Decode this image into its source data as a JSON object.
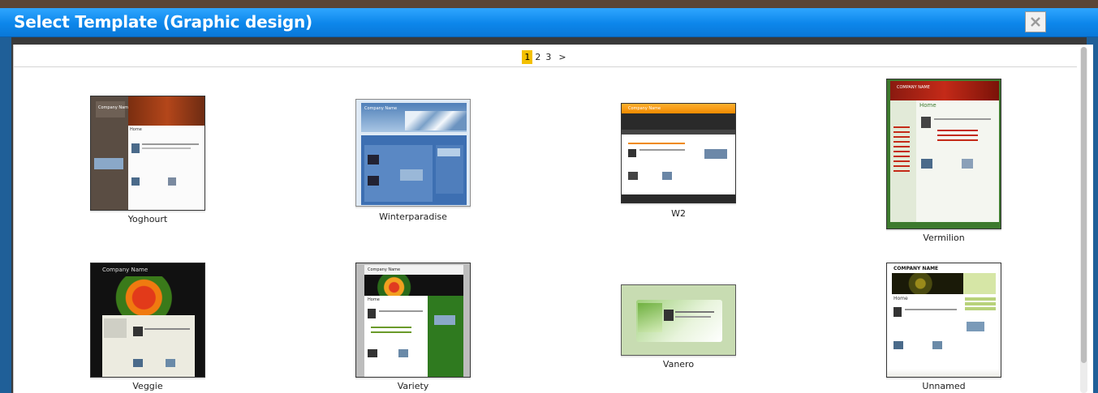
{
  "dialog": {
    "title": "Select Template (Graphic design)",
    "close_icon": "close-icon"
  },
  "pager": {
    "pages": [
      "1",
      "2",
      "3"
    ],
    "current": "1",
    "next_label": ">"
  },
  "templates": [
    {
      "name": "Yoghourt",
      "thumb_title": "Company Name",
      "thumb_heading": "Home"
    },
    {
      "name": "Winterparadise",
      "thumb_title": "Company Name"
    },
    {
      "name": "W2",
      "thumb_title": "Company Name"
    },
    {
      "name": "Vermilion",
      "thumb_title": "COMPANY NAME",
      "thumb_heading": "Home"
    },
    {
      "name": "Veggie",
      "thumb_title": "Company Name"
    },
    {
      "name": "Variety",
      "thumb_title": "Company Name",
      "thumb_heading": "Home"
    },
    {
      "name": "Vanero"
    },
    {
      "name": "Unnamed",
      "thumb_title": "COMPANY NAME",
      "thumb_heading": "Home"
    }
  ],
  "colors": {
    "titlebar": "#0c86ea",
    "active_page": "#f3c000"
  }
}
